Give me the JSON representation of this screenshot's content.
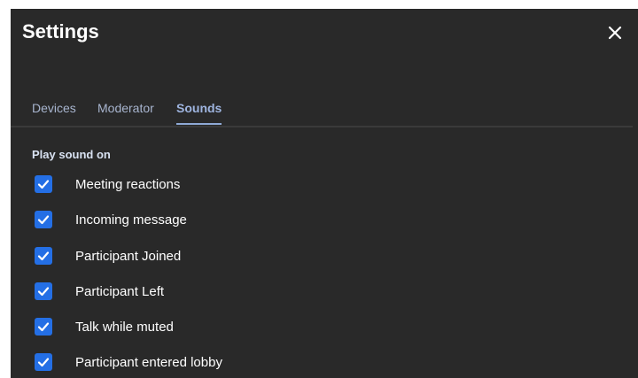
{
  "dialog": {
    "title": "Settings"
  },
  "tabs": [
    {
      "label": "Devices",
      "active": false
    },
    {
      "label": "Moderator",
      "active": false
    },
    {
      "label": "Sounds",
      "active": true
    }
  ],
  "sounds": {
    "section_label": "Play sound on",
    "options": [
      {
        "label": "Meeting reactions",
        "checked": true
      },
      {
        "label": "Incoming message",
        "checked": true
      },
      {
        "label": "Participant Joined",
        "checked": true
      },
      {
        "label": "Participant Left",
        "checked": true
      },
      {
        "label": "Talk while muted",
        "checked": true
      },
      {
        "label": "Participant entered lobby",
        "checked": true
      }
    ]
  },
  "colors": {
    "background": "#292929",
    "checkbox": "#246fe5",
    "tab_active": "#9fb5e0"
  }
}
